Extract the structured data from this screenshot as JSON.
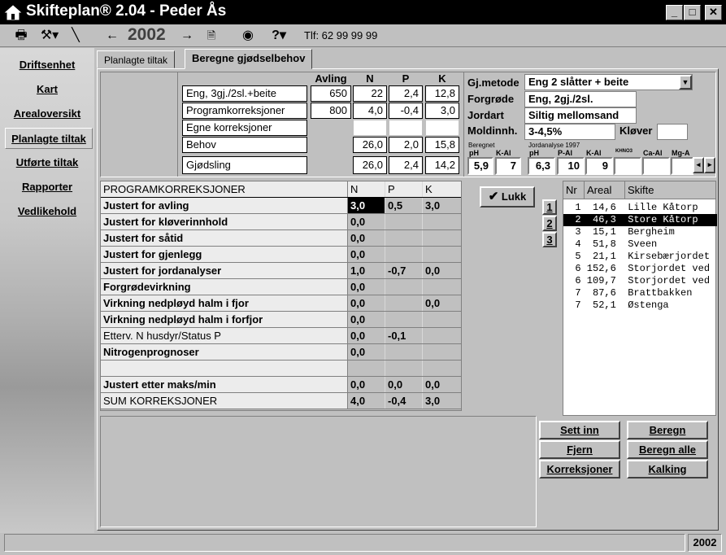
{
  "window": {
    "title": "Skifteplan® 2.04 - Peder Ås",
    "minimize": "_",
    "maximize": "□",
    "close": "✕"
  },
  "toolbar": {
    "year": "2002",
    "phone": "Tlf: 62 99 99 99",
    "icons": [
      "printer-icon",
      "tools-icon",
      "pen-icon",
      "arrow-left-icon",
      "arrow-right-icon",
      "document-icon",
      "globe-icon",
      "help-icon"
    ]
  },
  "sidebar": {
    "items": [
      {
        "label": "Driftsenhet"
      },
      {
        "label": "Kart"
      },
      {
        "label": "Arealoversikt"
      },
      {
        "label": "Planlagte tiltak"
      },
      {
        "label": "Utførte tiltak"
      },
      {
        "label": "Rapporter"
      },
      {
        "label": "Vedlikehold"
      }
    ]
  },
  "tabs": [
    {
      "label": "Planlagte tiltak"
    },
    {
      "label": "Beregne gjødselbehov"
    }
  ],
  "needs": {
    "headers": {
      "avling": "Avling",
      "n": "N",
      "p": "P",
      "k": "K"
    },
    "rows": [
      {
        "label": "Eng, 3gj./2sl.+beite",
        "avling": "650",
        "n": "22",
        "p": "2,4",
        "k": "12,8"
      },
      {
        "label": "Programkorreksjoner",
        "avling": "800",
        "n": "4,0",
        "p": "-0,4",
        "k": "3,0"
      },
      {
        "label": "Egne korreksjoner",
        "avling": "",
        "n": "",
        "p": "",
        "k": ""
      },
      {
        "label": "Behov",
        "avling": "",
        "n": "26,0",
        "p": "2,0",
        "k": "15,8"
      },
      {
        "label": "Gjødsling",
        "avling": "",
        "n": "26,0",
        "p": "2,4",
        "k": "14,2"
      }
    ]
  },
  "props": {
    "gjmetode_label": "Gj.metode",
    "gjmetode_value": "Eng 2 slåtter + beite",
    "forgrode_label": "Forgrøde",
    "forgrode_value": "Eng, 2gj./2sl.",
    "jordart_label": "Jordart",
    "jordart_value": "Siltig mellomsand",
    "moldinnh_label": "Moldinnh.",
    "moldinnh_value": "3-4,5%",
    "klover_label": "Kløver",
    "klover_value": ""
  },
  "soil": {
    "beregnet_label": "Beregnet",
    "jordanalyse_label": "Jordanalyse 1997",
    "headers": [
      "pH",
      "K-Al",
      "pH",
      "P-Al",
      "K-Al",
      "KHNO3",
      "Ca-Al",
      "Mg-A"
    ],
    "values": [
      "5,9",
      "7",
      "6,3",
      "10",
      "9",
      "",
      "",
      ""
    ]
  },
  "corrections": {
    "headers": {
      "label": "PROGRAMKORREKSJONER",
      "n": "N",
      "p": "P",
      "k": "K"
    },
    "rows": [
      {
        "label": "Justert for avling",
        "n": "3,0",
        "p": "0,5",
        "k": "3,0"
      },
      {
        "label": "Justert for kløverinnhold",
        "n": "0,0",
        "p": "",
        "k": ""
      },
      {
        "label": "Justert for såtid",
        "n": "0,0",
        "p": "",
        "k": ""
      },
      {
        "label": "Justert for gjenlegg",
        "n": "0,0",
        "p": "",
        "k": ""
      },
      {
        "label": "Justert for jordanalyser",
        "n": "1,0",
        "p": "-0,7",
        "k": "0,0"
      },
      {
        "label": "Forgrødevirkning",
        "n": "0,0",
        "p": "",
        "k": ""
      },
      {
        "label": "Virkning nedpløyd halm i fjor",
        "n": "0,0",
        "p": "",
        "k": "0,0"
      },
      {
        "label": "Virkning nedpløyd halm i forfjor",
        "n": "0,0",
        "p": "",
        "k": ""
      },
      {
        "label": "Etterv. N husdyr/Status P",
        "n": "0,0",
        "p": "-0,1",
        "k": ""
      },
      {
        "label": "Nitrogenprognoser",
        "n": "0,0",
        "p": "",
        "k": ""
      },
      {
        "label": "",
        "n": "",
        "p": "",
        "k": ""
      },
      {
        "label": "Justert etter maks/min",
        "n": "0,0",
        "p": "0,0",
        "k": "0,0"
      },
      {
        "label": "SUM KORREKSJONER",
        "n": "4,0",
        "p": "-0,4",
        "k": "3,0"
      }
    ]
  },
  "lukk_label": "Lukk",
  "year_buttons": [
    "1",
    "2",
    "3"
  ],
  "fields_list": {
    "headers": {
      "nr": "Nr",
      "areal": "Areal",
      "skifte": "Skifte"
    },
    "rows": [
      {
        "text": "  1  14,6  Lille Kåtorp",
        "selected": false
      },
      {
        "text": "  2  46,3  Store Kåtorp",
        "selected": true
      },
      {
        "text": "  3  15,1  Bergheim",
        "selected": false
      },
      {
        "text": "  4  51,8  Sveen",
        "selected": false
      },
      {
        "text": "  5  21,1  Kirsebærjordet",
        "selected": false
      },
      {
        "text": "  6 152,6  Storjordet ved",
        "selected": false
      },
      {
        "text": "  6 109,7  Storjordet ved",
        "selected": false
      },
      {
        "text": "  7  87,6  Brattbakken",
        "selected": false
      },
      {
        "text": "  7  52,1  Østenga",
        "selected": false
      }
    ]
  },
  "buttons": {
    "sett_inn": "Sett inn",
    "beregn": "Beregn",
    "fjern": "Fjern",
    "beregn_alle": "Beregn alle",
    "korreksjoner": "Korreksjoner",
    "kalking": "Kalking"
  },
  "status": {
    "year": "2002"
  }
}
